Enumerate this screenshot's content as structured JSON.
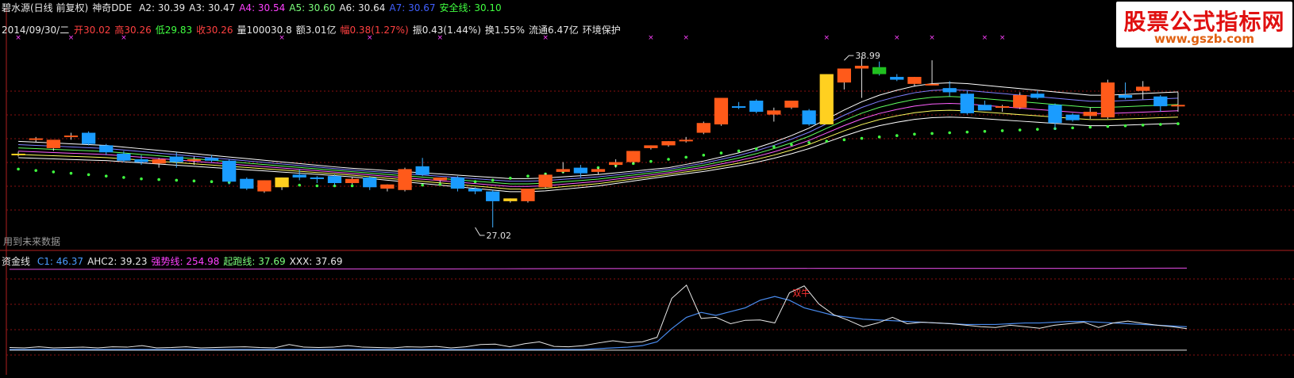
{
  "title_row": {
    "stock": "碧水源(日线 前复权)",
    "indicator": "神奇DDE",
    "items": [
      {
        "label": "A2:",
        "value": "30.39",
        "color": "#e8e8e8"
      },
      {
        "label": "A3:",
        "value": "30.47",
        "color": "#e8e8e8"
      },
      {
        "label": "A4:",
        "value": "30.54",
        "color": "#ff40ff"
      },
      {
        "label": "A5:",
        "value": "30.60",
        "color": "#7cff7c"
      },
      {
        "label": "A6:",
        "value": "30.64",
        "color": "#e8e8e8"
      },
      {
        "label": "A7:",
        "value": "30.67",
        "color": "#4060ff"
      },
      {
        "label": "安全线:",
        "value": "30.10",
        "color": "#40ff40"
      }
    ]
  },
  "info_row": {
    "date": "2014/09/30/二",
    "items": [
      {
        "label": "开",
        "value": "30.02",
        "color": "#ff4040"
      },
      {
        "label": "高",
        "value": "30.26",
        "color": "#ff4040"
      },
      {
        "label": "低",
        "value": "29.83",
        "color": "#40ff40"
      },
      {
        "label": "收",
        "value": "30.26",
        "color": "#ff4040"
      },
      {
        "label": "量",
        "value": "100030.8",
        "color": "#e8e8e8"
      },
      {
        "label": "额",
        "value": "3.01亿",
        "color": "#e8e8e8"
      },
      {
        "label": "幅",
        "value": "0.38(1.27%)",
        "color": "#ff4040"
      },
      {
        "label": "振",
        "value": "0.43(1.44%)",
        "color": "#e8e8e8"
      },
      {
        "label": "换",
        "value": "1.55%",
        "color": "#e8e8e8"
      },
      {
        "label": "流通",
        "value": "6.47亿",
        "color": "#e8e8e8"
      },
      {
        "label": "环境保护",
        "value": "",
        "color": "#e8e8e8"
      }
    ]
  },
  "brand": {
    "name": "股票公式指标网",
    "url": "www.gszb.com"
  },
  "future_note": "用到未来数据",
  "indicator_row": {
    "name": "资金线",
    "items": [
      {
        "label": "C1:",
        "value": "46.37",
        "color": "#4a9cff"
      },
      {
        "label": "AHC2:",
        "value": "39.23",
        "color": "#e8e8e8"
      },
      {
        "label": "强势线:",
        "value": "254.98",
        "color": "#ff40ff"
      },
      {
        "label": "起跑线:",
        "value": "37.69",
        "color": "#7cff7c"
      },
      {
        "label": "XXX:",
        "value": "37.69",
        "color": "#e8e8e8"
      }
    ]
  },
  "colors": {
    "up": "#ff5a1a",
    "down": "#1a9cff",
    "grid": "#8a1010",
    "dots": "#40ff40",
    "crosses": "#ff40ff"
  },
  "chart_data": {
    "type": "candlestick",
    "price_axis": {
      "min": 26.0,
      "max": 40.3
    },
    "annotations": [
      {
        "label": "38.99",
        "value": 38.99,
        "index": 47
      },
      {
        "label": "27.02",
        "value": 27.02,
        "index": 26
      }
    ],
    "candles": [
      {
        "o": 32.3,
        "h": 32.45,
        "c": 32.3,
        "l": 32.1,
        "v": "y"
      },
      {
        "o": 33.3,
        "h": 33.5,
        "c": 33.4,
        "l": 33.1
      },
      {
        "o": 32.7,
        "h": 33.1,
        "c": 33.3,
        "l": 32.5
      },
      {
        "o": 33.5,
        "h": 33.8,
        "c": 33.6,
        "l": 33.3
      },
      {
        "o": 33.8,
        "h": 33.9,
        "c": 33.0,
        "l": 32.9
      },
      {
        "o": 32.9,
        "h": 33.0,
        "c": 32.4,
        "l": 32.2
      },
      {
        "o": 32.3,
        "h": 32.5,
        "c": 31.8,
        "l": 31.7
      },
      {
        "o": 31.9,
        "h": 32.2,
        "c": 31.7,
        "l": 31.5
      },
      {
        "o": 31.6,
        "h": 32.0,
        "c": 31.9,
        "l": 31.3
      },
      {
        "o": 32.1,
        "h": 32.4,
        "c": 31.7,
        "l": 31.3
      },
      {
        "o": 31.9,
        "h": 32.1,
        "c": 31.9,
        "l": 31.5
      },
      {
        "o": 32.0,
        "h": 32.2,
        "c": 31.8,
        "l": 31.7
      },
      {
        "o": 31.8,
        "h": 31.9,
        "c": 30.3,
        "l": 30.1
      },
      {
        "o": 30.5,
        "h": 30.6,
        "c": 29.8,
        "l": 29.7
      },
      {
        "o": 29.6,
        "h": 30.4,
        "c": 30.4,
        "l": 29.5
      },
      {
        "o": 29.9,
        "h": 30.6,
        "c": 30.6,
        "l": 29.7,
        "v": "y"
      },
      {
        "o": 30.8,
        "h": 31.2,
        "c": 30.6,
        "l": 30.4
      },
      {
        "o": 30.6,
        "h": 30.7,
        "c": 30.5,
        "l": 30.2
      },
      {
        "o": 30.7,
        "h": 30.8,
        "c": 30.2,
        "l": 30.0
      },
      {
        "o": 30.2,
        "h": 30.6,
        "c": 30.5,
        "l": 30.1
      },
      {
        "o": 30.6,
        "h": 30.7,
        "c": 29.9,
        "l": 29.7
      },
      {
        "o": 29.8,
        "h": 30.1,
        "c": 30.1,
        "l": 29.6
      },
      {
        "o": 29.7,
        "h": 31.3,
        "c": 31.2,
        "l": 29.6
      },
      {
        "o": 31.4,
        "h": 32.0,
        "c": 30.8,
        "l": 30.7
      },
      {
        "o": 30.4,
        "h": 30.6,
        "c": 30.6,
        "l": 30.2
      },
      {
        "o": 30.6,
        "h": 30.7,
        "c": 29.8,
        "l": 29.6
      },
      {
        "o": 29.8,
        "h": 29.9,
        "c": 29.6,
        "l": 29.4
      },
      {
        "o": 29.6,
        "h": 29.7,
        "c": 28.9,
        "l": 27.02
      },
      {
        "o": 28.9,
        "h": 29.1,
        "c": 29.1,
        "l": 28.8,
        "v": "y"
      },
      {
        "o": 28.9,
        "h": 29.7,
        "c": 29.8,
        "l": 28.8
      },
      {
        "o": 29.9,
        "h": 30.9,
        "c": 30.8,
        "l": 29.8
      },
      {
        "o": 31.0,
        "h": 31.7,
        "c": 31.2,
        "l": 30.9
      },
      {
        "o": 31.3,
        "h": 31.5,
        "c": 30.9,
        "l": 30.6
      },
      {
        "o": 31.0,
        "h": 31.3,
        "c": 31.2,
        "l": 30.8
      },
      {
        "o": 31.5,
        "h": 31.9,
        "c": 31.7,
        "l": 31.3
      },
      {
        "o": 31.7,
        "h": 32.5,
        "c": 32.5,
        "l": 31.6
      },
      {
        "o": 32.7,
        "h": 32.9,
        "c": 32.9,
        "l": 32.6
      },
      {
        "o": 32.9,
        "h": 33.2,
        "c": 33.2,
        "l": 32.8
      },
      {
        "o": 33.2,
        "h": 33.5,
        "c": 33.3,
        "l": 33.1
      },
      {
        "o": 33.8,
        "h": 34.6,
        "c": 34.5,
        "l": 33.7
      },
      {
        "o": 34.4,
        "h": 36.3,
        "c": 36.3,
        "l": 34.3
      },
      {
        "o": 35.7,
        "h": 36.0,
        "c": 35.6,
        "l": 35.5
      },
      {
        "o": 36.1,
        "h": 36.2,
        "c": 35.3,
        "l": 35.2
      },
      {
        "o": 35.1,
        "h": 35.6,
        "c": 35.4,
        "l": 34.6
      },
      {
        "o": 35.6,
        "h": 36.0,
        "c": 36.1,
        "l": 35.5
      },
      {
        "o": 35.4,
        "h": 35.5,
        "c": 34.4,
        "l": 34.3
      },
      {
        "o": 34.4,
        "h": 38.0,
        "c": 38.0,
        "l": 34.4,
        "v": "y"
      },
      {
        "o": 37.4,
        "h": 38.2,
        "c": 38.4,
        "l": 36.9
      },
      {
        "o": 38.4,
        "h": 39.3,
        "c": 38.6,
        "l": 36.3
      },
      {
        "o": 38.5,
        "h": 38.9,
        "c": 38.0,
        "l": 37.9,
        "v": "g"
      },
      {
        "o": 37.8,
        "h": 38.0,
        "c": 37.6,
        "l": 37.5
      },
      {
        "o": 37.3,
        "h": 37.8,
        "c": 37.8,
        "l": 37.1
      },
      {
        "o": 37.2,
        "h": 38.99,
        "c": 37.3,
        "l": 37.2
      },
      {
        "o": 37.0,
        "h": 37.5,
        "c": 36.7,
        "l": 36.4
      },
      {
        "o": 36.6,
        "h": 36.8,
        "c": 35.2,
        "l": 35.1
      },
      {
        "o": 35.8,
        "h": 36.1,
        "c": 35.4,
        "l": 35.4
      },
      {
        "o": 35.7,
        "h": 35.8,
        "c": 35.7,
        "l": 35.3
      },
      {
        "o": 35.6,
        "h": 36.7,
        "c": 36.5,
        "l": 35.5
      },
      {
        "o": 36.6,
        "h": 36.8,
        "c": 36.3,
        "l": 36.2
      },
      {
        "o": 35.8,
        "h": 35.9,
        "c": 34.5,
        "l": 34.0
      },
      {
        "o": 35.1,
        "h": 35.2,
        "c": 34.7,
        "l": 34.6
      },
      {
        "o": 35.0,
        "h": 35.6,
        "c": 35.3,
        "l": 34.8
      },
      {
        "o": 34.9,
        "h": 37.6,
        "c": 37.4,
        "l": 34.8
      },
      {
        "o": 36.5,
        "h": 37.4,
        "c": 36.3,
        "l": 36.2
      },
      {
        "o": 36.8,
        "h": 37.5,
        "c": 37.1,
        "l": 36.2
      },
      {
        "o": 36.4,
        "h": 36.5,
        "c": 35.7,
        "l": 35.3
      },
      {
        "o": 35.8,
        "h": 36.7,
        "c": 35.8,
        "l": 35.3
      }
    ],
    "ma_lines": {
      "colors": [
        "#ffffff",
        "#ffff60",
        "#ff60ff",
        "#60ff60",
        "#8080ff",
        "#ffffff"
      ],
      "base": [
        32.6,
        32.55,
        32.5,
        32.45,
        32.4,
        32.35,
        32.25,
        32.15,
        32.05,
        31.95,
        31.85,
        31.75,
        31.65,
        31.55,
        31.45,
        31.35,
        31.25,
        31.15,
        31.05,
        30.95,
        30.85,
        30.75,
        30.65,
        30.55,
        30.45,
        30.35,
        30.25,
        30.15,
        30.05,
        30.05,
        30.1,
        30.2,
        30.3,
        30.4,
        30.55,
        30.7,
        30.85,
        31.0,
        31.2,
        31.4,
        31.65,
        31.9,
        32.2,
        32.55,
        32.95,
        33.4,
        33.95,
        34.5,
        35.0,
        35.4,
        35.7,
        35.95,
        36.1,
        36.15,
        36.1,
        36.0,
        35.9,
        35.8,
        35.7,
        35.6,
        35.5,
        35.4,
        35.4,
        35.45,
        35.5,
        35.55,
        35.6
      ]
    },
    "safety_dots": [
      31.2,
      31.1,
      31.0,
      30.9,
      30.8,
      30.7,
      30.6,
      30.5,
      30.45,
      30.4,
      30.35,
      30.3,
      30.25,
      30.2,
      30.15,
      30.1,
      30.05,
      30.0,
      30.0,
      30.0,
      30.0,
      30.0,
      30.0,
      30.05,
      30.1,
      30.2,
      30.3,
      30.4,
      30.55,
      30.7,
      30.85,
      31.0,
      31.15,
      31.3,
      31.45,
      31.6,
      31.75,
      31.9,
      32.05,
      32.2,
      32.35,
      32.5,
      32.65,
      32.8,
      32.95,
      33.1,
      33.2,
      33.3,
      33.4,
      33.5,
      33.6,
      33.7,
      33.75,
      33.8,
      33.85,
      33.9,
      33.95,
      34.0,
      34.05,
      34.1,
      34.15,
      34.2,
      34.25,
      34.3,
      34.35,
      34.4,
      34.45
    ],
    "indicator": {
      "min": 0,
      "max": 260,
      "strong_line": [
        252,
        252,
        252,
        252.5,
        253,
        253,
        253,
        253.5,
        254,
        254,
        254,
        254.5,
        254.5,
        254.5,
        254.5,
        254.5,
        254.98
      ],
      "white_line": [
        45,
        44,
        47,
        44,
        45,
        46,
        44,
        47,
        46,
        50,
        44,
        45,
        47,
        44,
        45,
        46,
        47,
        45,
        44,
        53,
        46,
        45,
        46,
        50,
        46,
        45,
        44,
        47,
        46,
        48,
        44,
        47,
        53,
        54,
        47,
        55,
        60,
        48,
        47,
        50,
        57,
        63,
        58,
        60,
        72,
        175,
        210,
        122,
        125,
        108,
        117,
        118,
        110,
        190,
        208,
        160,
        132,
        117,
        100,
        110,
        125,
        108,
        112,
        110,
        108,
        104,
        100,
        98,
        104,
        100,
        96,
        104,
        108,
        112,
        98,
        110,
        115,
        109,
        104,
        100,
        95
      ],
      "blue_line": [
        40,
        40,
        40,
        40,
        40,
        40,
        40,
        40,
        40,
        40,
        40,
        40,
        40,
        40,
        40,
        40,
        40,
        40,
        40,
        40,
        40,
        40,
        40,
        40,
        40,
        40,
        40,
        40,
        40,
        40,
        40,
        40,
        40,
        40,
        40,
        40,
        40,
        40,
        40,
        40,
        42,
        44,
        46,
        50,
        60,
        95,
        125,
        138,
        130,
        140,
        150,
        170,
        180,
        170,
        150,
        140,
        130,
        125,
        120,
        118,
        116,
        114,
        112,
        110,
        108,
        106,
        106,
        106,
        108,
        110,
        110,
        112,
        114,
        114,
        112,
        110,
        108,
        106,
        104,
        102,
        100
      ],
      "baseline": 38,
      "cross_label": "双牛"
    }
  }
}
